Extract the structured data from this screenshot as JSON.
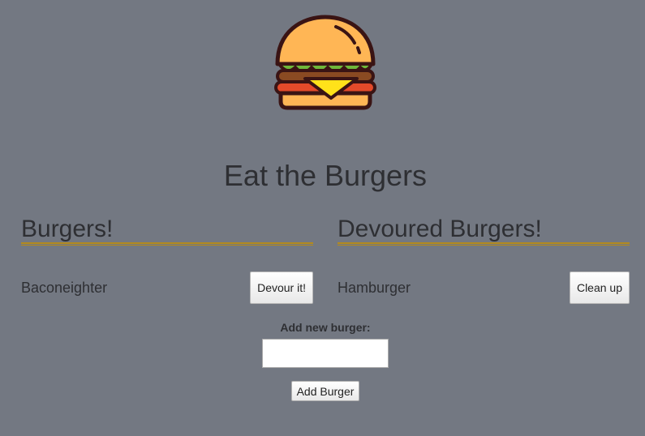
{
  "header": {
    "logo_icon": "burger-icon",
    "title": "Eat the Burgers"
  },
  "columns": {
    "uneaten": {
      "title": "Burgers!",
      "items": [
        {
          "name": "Baconeighter",
          "action_label": "Devour it!"
        }
      ]
    },
    "devoured": {
      "title": "Devoured Burgers!",
      "items": [
        {
          "name": "Hamburger",
          "action_label": "Clean up"
        }
      ]
    }
  },
  "form": {
    "label": "Add new burger:",
    "input_value": "",
    "submit_label": "Add Burger"
  },
  "colors": {
    "background": "#737882",
    "rule": "#b38a1e",
    "bun": "#ffb655",
    "cheese": "#ffe21a",
    "lettuce": "#6fb83a",
    "tomato": "#e44a2a",
    "outline": "#3a1414"
  }
}
